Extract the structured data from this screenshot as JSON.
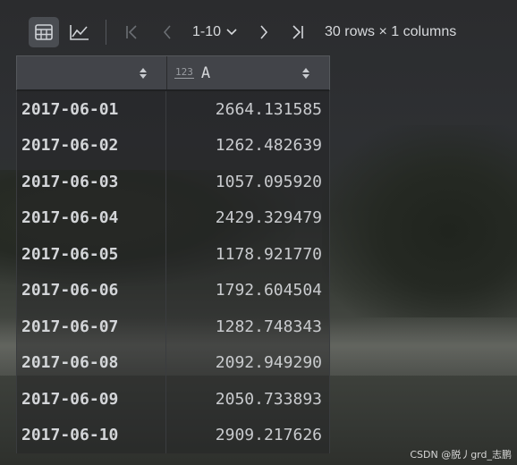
{
  "toolbar": {
    "table_view_icon": "table-icon",
    "chart_view_icon": "line-chart-icon",
    "first_icon": "first-page-icon",
    "prev_icon": "prev-page-icon",
    "page_range": "1-10",
    "dropdown_icon": "chevron-down-icon",
    "next_icon": "next-page-icon",
    "last_icon": "last-page-icon",
    "rows_info": "30 rows × 1 columns"
  },
  "table": {
    "index_header": "",
    "columns": [
      {
        "type_label": "123",
        "name": "A"
      }
    ],
    "rows": [
      {
        "index": "2017-06-01",
        "A": "2664.131585"
      },
      {
        "index": "2017-06-02",
        "A": "1262.482639"
      },
      {
        "index": "2017-06-03",
        "A": "1057.095920"
      },
      {
        "index": "2017-06-04",
        "A": "2429.329479"
      },
      {
        "index": "2017-06-05",
        "A": "1178.921770"
      },
      {
        "index": "2017-06-06",
        "A": "1792.604504"
      },
      {
        "index": "2017-06-07",
        "A": "1282.748343"
      },
      {
        "index": "2017-06-08",
        "A": "2092.949290"
      },
      {
        "index": "2017-06-09",
        "A": "2050.733893"
      },
      {
        "index": "2017-06-10",
        "A": "2909.217626"
      }
    ]
  },
  "watermark": "CSDN @脱丿grd_志鹏"
}
